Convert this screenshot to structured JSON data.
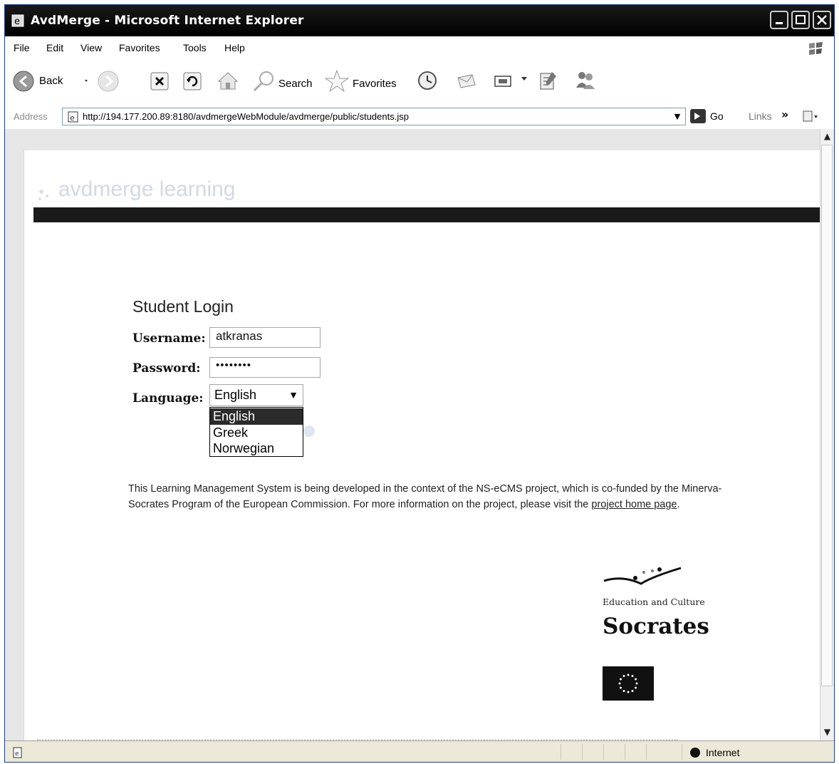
{
  "window": {
    "title": "AvdMerge - Microsoft Internet Explorer"
  },
  "menu": {
    "items": [
      "File",
      "Edit",
      "View",
      "Favorites",
      "Tools",
      "Help"
    ]
  },
  "toolbar": {
    "back": "Back",
    "search": "Search",
    "favorites": "Favorites"
  },
  "address": {
    "label": "Address",
    "url": "http://194.177.200.89:8180/avdmergeWebModule/avdmerge/public/students.jsp",
    "go": "Go",
    "links": "Links",
    "more": "»"
  },
  "page": {
    "brand": "avdmerge learning",
    "login_title": "Student Login",
    "username_label": "Username:",
    "username_value": "atkranas",
    "password_label": "Password:",
    "password_value": "••••••••",
    "language_label": "Language:",
    "language_selected": "English",
    "language_options": [
      "English",
      "Greek",
      "Norwegian"
    ],
    "info_text": "This Learning Management System is being developed in the context of the NS-eCMS project, which is co-funded by the Minerva-Socrates Program of the European Commission. For more information on the project, please visit the ",
    "info_link": "project home page",
    "info_end": ".",
    "socrates_edu": "Education and Culture",
    "socrates_name": "Socrates"
  },
  "status": {
    "zone": "Internet"
  }
}
